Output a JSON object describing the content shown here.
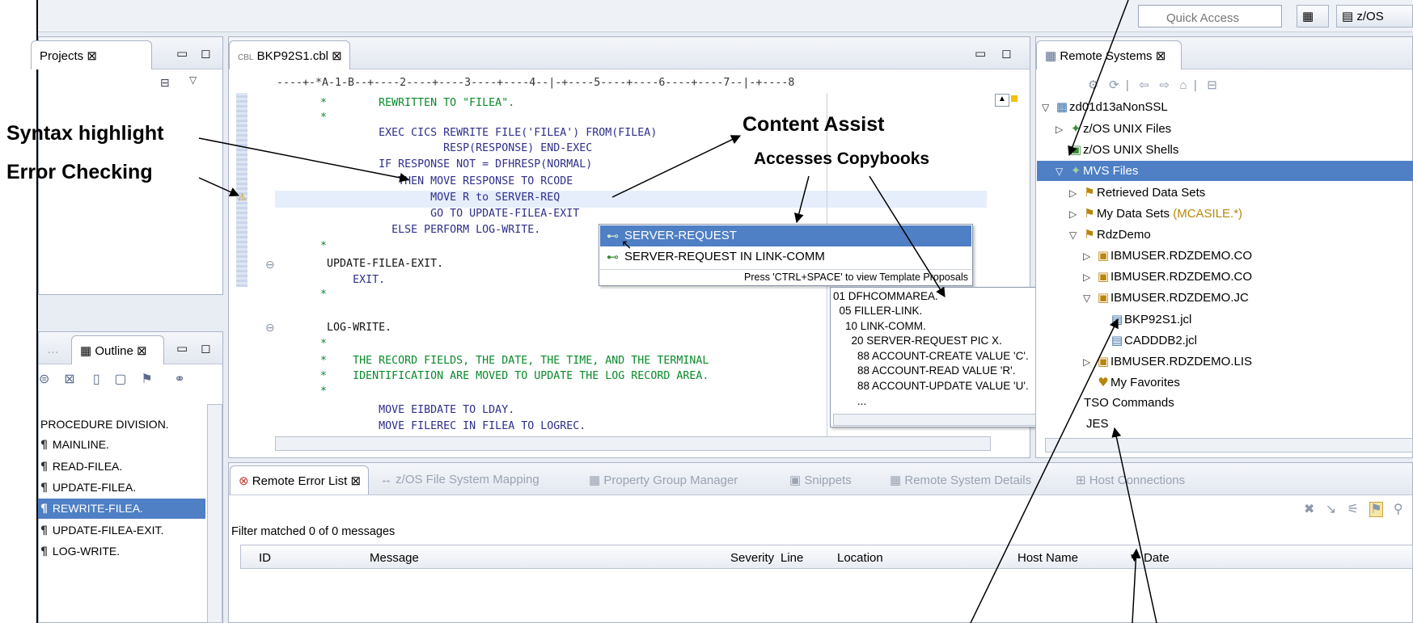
{
  "toolbar": {
    "quick_access_placeholder": "Quick Access",
    "perspective_label": "z/OS"
  },
  "projects_view": {
    "tab_label": "Projects ⊠"
  },
  "editor": {
    "tab_label": "BKP92S1.cbl ⊠",
    "ruler": "----+-*A-1-B--+----2----+----3----+----4--|-+----5----+----6----+----7--|-+----8",
    "lines": [
      "       *        REWRITTEN TO \"FILEA\".",
      "       *",
      "                EXEC CICS REWRITE FILE('FILEA') FROM(FILEA)",
      "                          RESP(RESPONSE) END-EXEC",
      "                IF RESPONSE NOT = DFHRESP(NORMAL)",
      "                   THEN MOVE RESPONSE TO RCODE",
      "                        MOVE R to SERVER-REQ",
      "                        GO TO UPDATE-FILEA-EXIT",
      "                  ELSE PERFORM LOG-WRITE.",
      "       *",
      "        UPDATE-FILEA-EXIT.",
      "            EXIT.",
      "       *",
      "",
      "        LOG-WRITE.",
      "       *",
      "       *    THE RECORD FIELDS, THE DATE, THE TIME, AND THE TERMINAL",
      "       *    IDENTIFICATION ARE MOVED TO UPDATE THE LOG RECORD AREA.",
      "       *",
      "                MOVE EIBDATE TO LDAY.",
      "                MOVE FILEREC IN FILEA TO LOGREC."
    ]
  },
  "content_assist": {
    "items": [
      "SERVER-REQUEST",
      "SERVER-REQUEST IN LINK-COMM"
    ],
    "hint": "Press 'CTRL+SPACE' to view Template Proposals"
  },
  "copybook_popup": {
    "lines": [
      "01 DFHCOMMAREA.",
      "  05 FILLER-LINK.",
      "    10 LINK-COMM.",
      "      20 SERVER-REQUEST PIC X.",
      "        88 ACCOUNT-CREATE VALUE 'C'.",
      "        88 ACCOUNT-READ VALUE 'R'.",
      "        88 ACCOUNT-UPDATE VALUE 'U'.",
      "        ..."
    ]
  },
  "remote_systems": {
    "tab_label": "Remote Systems ⊠",
    "tree": [
      {
        "label": "zd01d13aNonSSL",
        "extra": ""
      },
      {
        "label": "z/OS UNIX Files",
        "extra": ""
      },
      {
        "label": "z/OS UNIX Shells",
        "extra": ""
      },
      {
        "label": "MVS Files",
        "extra": ""
      },
      {
        "label": "Retrieved Data Sets",
        "extra": ""
      },
      {
        "label": "My Data Sets",
        "extra": "(MCASILE.*)"
      },
      {
        "label": "RdzDemo",
        "extra": ""
      },
      {
        "label": "IBMUSER.RDZDEMO.CO",
        "extra": ""
      },
      {
        "label": "IBMUSER.RDZDEMO.CO",
        "extra": ""
      },
      {
        "label": "IBMUSER.RDZDEMO.JC",
        "extra": ""
      },
      {
        "label": "BKP92S1.jcl",
        "extra": ""
      },
      {
        "label": "CADDDB2.jcl",
        "extra": ""
      },
      {
        "label": "IBMUSER.RDZDEMO.LIS",
        "extra": ""
      },
      {
        "label": "My Favorites",
        "extra": ""
      },
      {
        "label": "TSO Commands",
        "extra": ""
      },
      {
        "label": "JES",
        "extra": ""
      }
    ]
  },
  "outline": {
    "tab_label": "Outline ⊠",
    "items": [
      "PROCEDURE DIVISION.",
      "MAINLINE.",
      "READ-FILEA.",
      "UPDATE-FILEA.",
      "REWRITE-FILEA.",
      "UPDATE-FILEA-EXIT.",
      "LOG-WRITE."
    ]
  },
  "bottom_tabs": [
    "Remote Error List ⊠",
    "z/OS File System Mapping",
    "Property Group Manager",
    "Snippets",
    "Remote System Details",
    "Host Connections"
  ],
  "error_list": {
    "filter_text": "Filter matched 0 of 0 messages",
    "columns": [
      "ID",
      "Message",
      "Severity",
      "Line",
      "Location",
      "Host Name",
      "Date"
    ]
  },
  "annotations": {
    "syntax": "Syntax  highlight",
    "error": "Error Checking",
    "content_assist": "Content Assist",
    "copybooks": "Accesses Copybooks"
  },
  "colors": {
    "selection": "#4f7fc4",
    "keyword": "#7f0055",
    "comment": "#0a8a2a",
    "code": "#2f2f8a"
  }
}
